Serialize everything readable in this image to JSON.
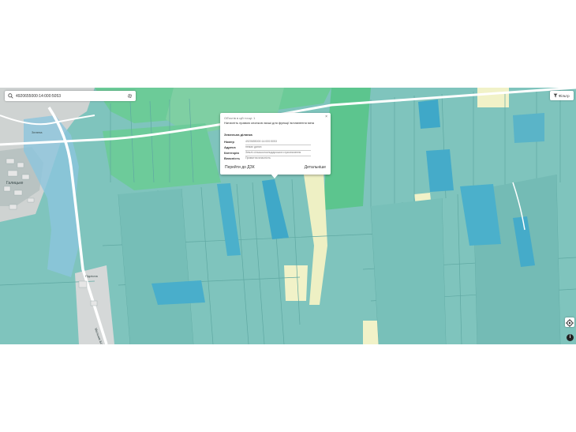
{
  "search": {
    "value": "4920655000:14:000:5053"
  },
  "filter": {
    "label": "Фільтр"
  },
  "popup": {
    "found_text": "Об'єктів в цій точці: 1",
    "hint": "Натисніть правою кнопкою миші для функції вставлення міна",
    "section_title": "Земельна ділянка",
    "fields": [
      {
        "key": "Номер",
        "value": "4920655000:14:000:5053"
      },
      {
        "key": "Адреса",
        "value": "немає даних"
      },
      {
        "key": "Категорія",
        "value": "Землі сільськогосподарського призначення"
      },
      {
        "key": "Власність",
        "value": "Приватна власність"
      }
    ],
    "go_button": "Перейти до ДЗК",
    "more_button": "Детальніше",
    "close_glyph": "×"
  },
  "map": {
    "labels": {
      "village": "Галицьке",
      "road_1": "Зелена",
      "road_2": "Підлісна",
      "road_3": "Мельник Бізнес"
    },
    "colors": {
      "parcel_teal": "#7ec6be",
      "parcel_dark": "#6fb8b1",
      "parcel_blue": "#3fa8c8",
      "forest_green": "#5cc58e",
      "light_green": "#8fdcaa",
      "cream": "#f1f2c8",
      "road": "#ffffff",
      "urban": "#c9cacb"
    }
  },
  "icons": {
    "search": "search-icon",
    "settings": "gear-icon",
    "filter": "filter-icon",
    "locate": "locate-icon",
    "info": "info-icon",
    "close": "close-icon"
  }
}
